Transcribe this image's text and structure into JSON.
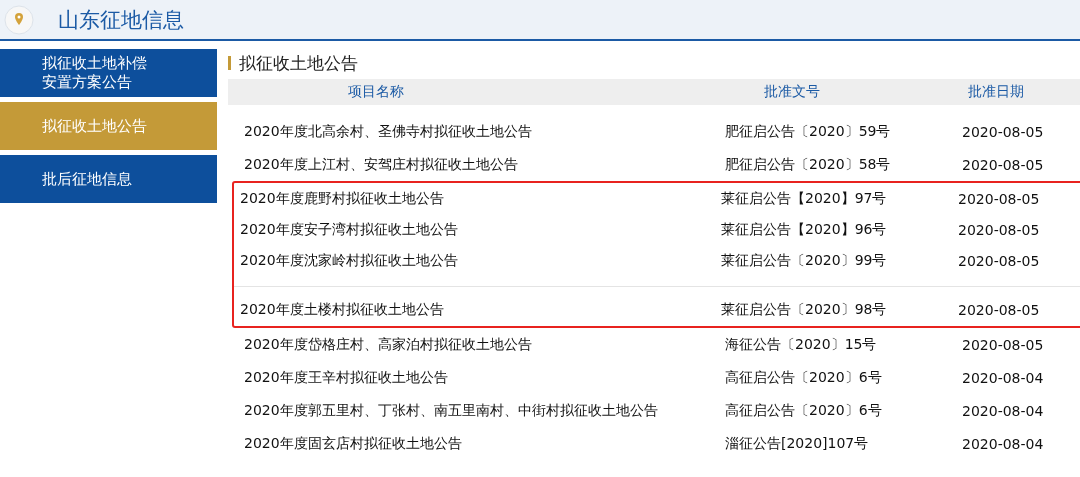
{
  "header": {
    "title": "山东征地信息"
  },
  "sidebar": {
    "items": [
      {
        "label": "拟征收土地补偿安置方案公告",
        "selected": false
      },
      {
        "label": "拟征收土地公告",
        "selected": true
      },
      {
        "label": "批后征地信息",
        "selected": false
      }
    ]
  },
  "section": {
    "title": "拟征收土地公告"
  },
  "table": {
    "columns": [
      "项目名称",
      "批准文号",
      "批准日期"
    ],
    "rows": [
      {
        "cells": [
          "2020年度北高余村、圣佛寺村拟征收土地公告",
          "肥征启公告〔2020〕59号",
          "2020-08-05"
        ],
        "highlighted": false,
        "gap_before": false
      },
      {
        "cells": [
          "2020年度上江村、安驾庄村拟征收土地公告",
          "肥征启公告〔2020〕58号",
          "2020-08-05"
        ],
        "highlighted": false,
        "gap_before": false
      },
      {
        "cells": [
          "2020年度鹿野村拟征收土地公告",
          "莱征启公告【2020】97号",
          "2020-08-05"
        ],
        "highlighted": true,
        "gap_before": false
      },
      {
        "cells": [
          "2020年度安子湾村拟征收土地公告",
          "莱征启公告【2020】96号",
          "2020-08-05"
        ],
        "highlighted": true,
        "gap_before": false
      },
      {
        "cells": [
          "2020年度沈家岭村拟征收土地公告",
          "莱征启公告〔2020〕99号",
          "2020-08-05"
        ],
        "highlighted": true,
        "gap_before": false
      },
      {
        "cells": [
          "2020年度土楼村拟征收土地公告",
          "莱征启公告〔2020〕98号",
          "2020-08-05"
        ],
        "highlighted": true,
        "gap_before": true
      },
      {
        "cells": [
          "2020年度岱格庄村、高家泊村拟征收土地公告",
          "海征公告〔2020〕15号",
          "2020-08-05"
        ],
        "highlighted": false,
        "gap_before": false
      },
      {
        "cells": [
          "2020年度王辛村拟征收土地公告",
          "高征启公告〔2020〕6号",
          "2020-08-04"
        ],
        "highlighted": false,
        "gap_before": false
      },
      {
        "cells": [
          "2020年度郭五里村、丁张村、南五里南村、中街村拟征收土地公告",
          "高征启公告〔2020〕6号",
          "2020-08-04"
        ],
        "highlighted": false,
        "gap_before": false
      },
      {
        "cells": [
          "2020年度固玄店村拟征收土地公告",
          "淄征公告[2020]107号",
          "2020-08-04"
        ],
        "highlighted": false,
        "gap_before": false
      }
    ]
  }
}
